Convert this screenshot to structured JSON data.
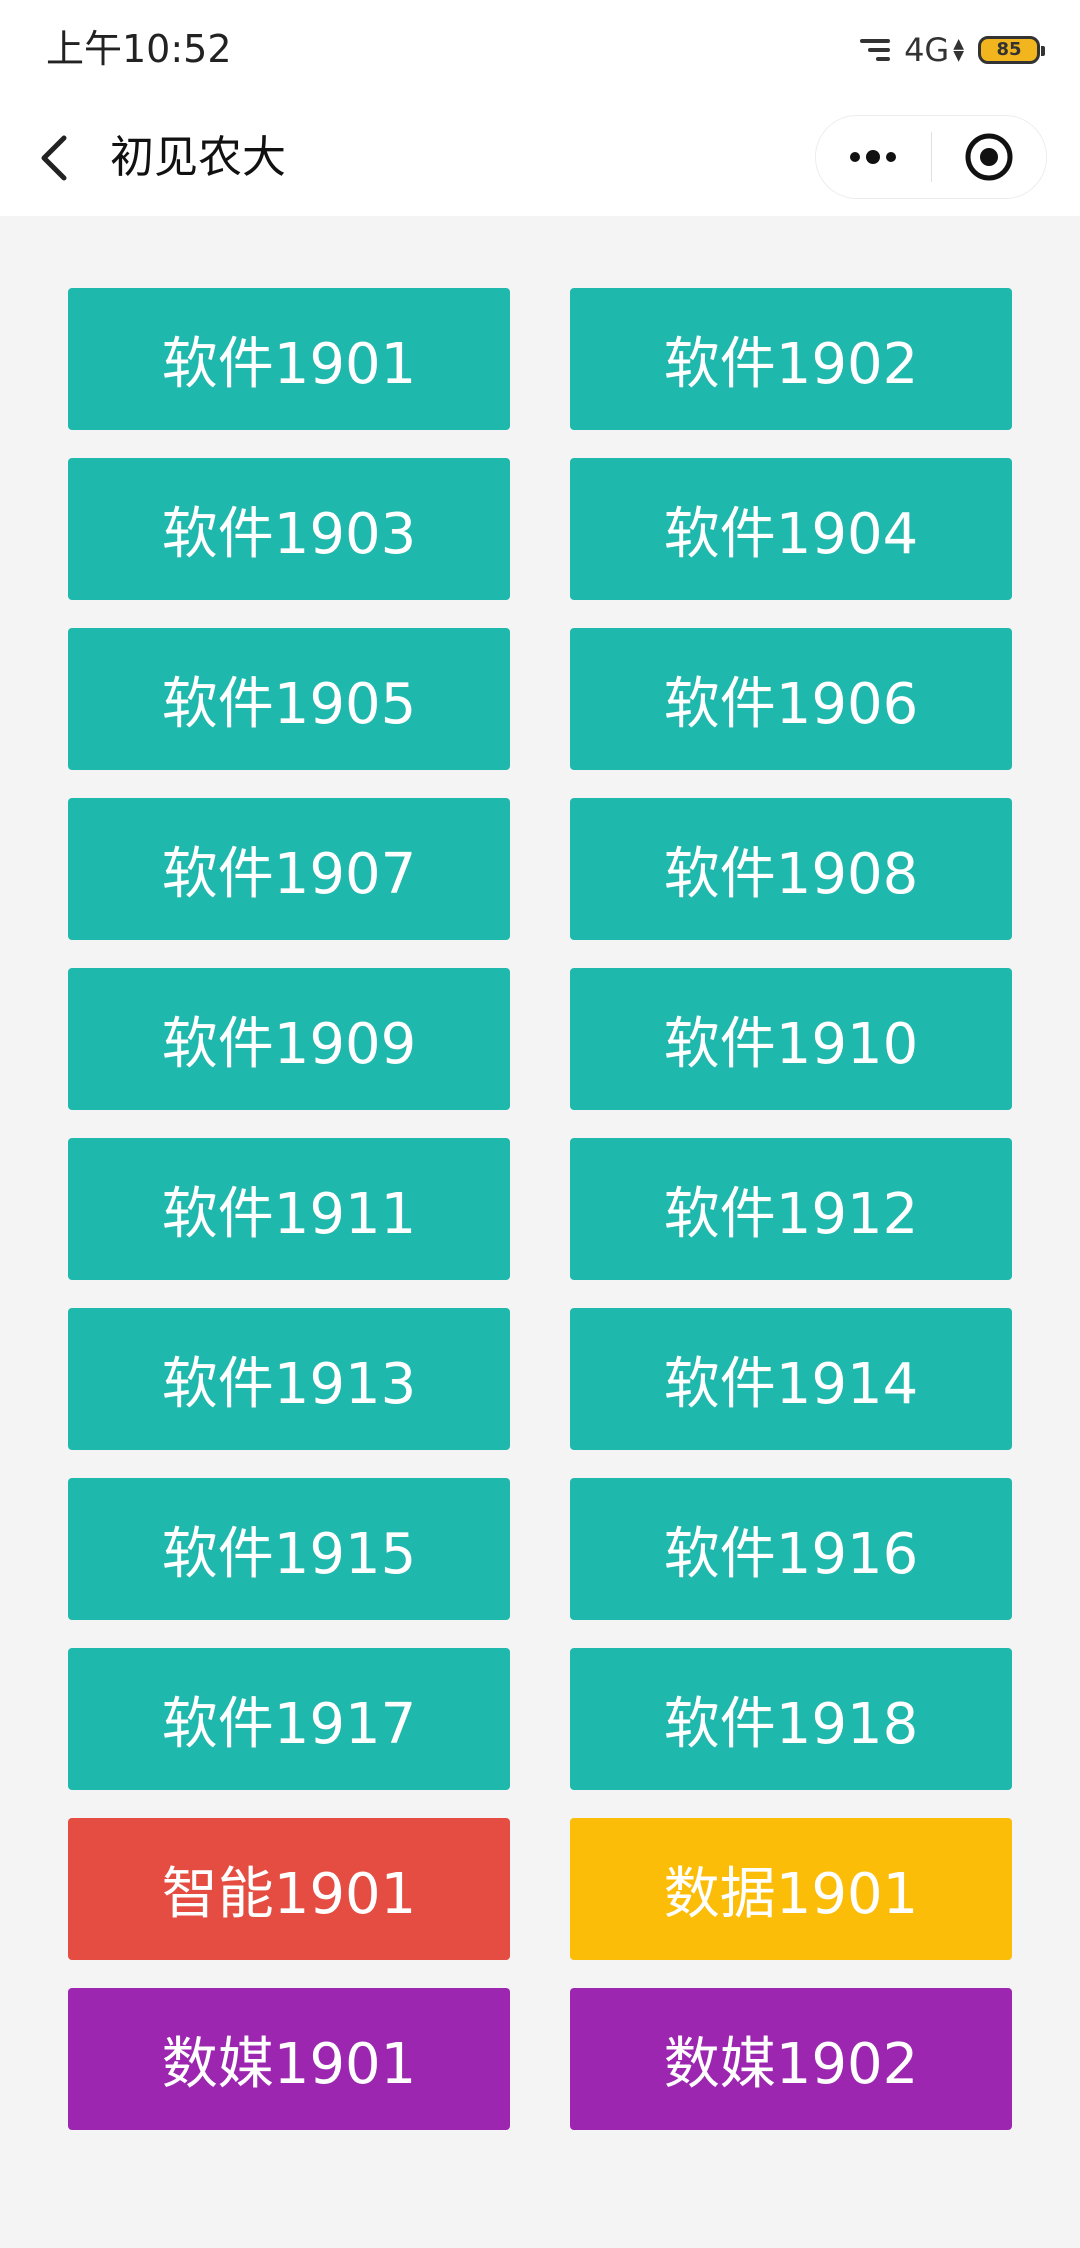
{
  "status_bar": {
    "time": "上午10:52",
    "network": "4G",
    "battery_level": "85",
    "battery_color": "#f2b51e"
  },
  "nav": {
    "title": "初见农大",
    "back_icon": "chevron-left-icon",
    "more_icon": "more-dots-icon",
    "close_icon": "target-circle-icon"
  },
  "colors": {
    "software": "#1fb8ad",
    "intelligence": "#e54d42",
    "data": "#fbbd08",
    "media": "#9c26b0",
    "background": "#f4f4f4"
  },
  "classes": [
    {
      "label": "软件1901",
      "color": "#1fb8ad"
    },
    {
      "label": "软件1902",
      "color": "#1fb8ad"
    },
    {
      "label": "软件1903",
      "color": "#1fb8ad"
    },
    {
      "label": "软件1904",
      "color": "#1fb8ad"
    },
    {
      "label": "软件1905",
      "color": "#1fb8ad"
    },
    {
      "label": "软件1906",
      "color": "#1fb8ad"
    },
    {
      "label": "软件1907",
      "color": "#1fb8ad"
    },
    {
      "label": "软件1908",
      "color": "#1fb8ad"
    },
    {
      "label": "软件1909",
      "color": "#1fb8ad"
    },
    {
      "label": "软件1910",
      "color": "#1fb8ad"
    },
    {
      "label": "软件1911",
      "color": "#1fb8ad"
    },
    {
      "label": "软件1912",
      "color": "#1fb8ad"
    },
    {
      "label": "软件1913",
      "color": "#1fb8ad"
    },
    {
      "label": "软件1914",
      "color": "#1fb8ad"
    },
    {
      "label": "软件1915",
      "color": "#1fb8ad"
    },
    {
      "label": "软件1916",
      "color": "#1fb8ad"
    },
    {
      "label": "软件1917",
      "color": "#1fb8ad"
    },
    {
      "label": "软件1918",
      "color": "#1fb8ad"
    },
    {
      "label": "智能1901",
      "color": "#e54d42"
    },
    {
      "label": "数据1901",
      "color": "#fbbd08"
    },
    {
      "label": "数媒1901",
      "color": "#9c26b0"
    },
    {
      "label": "数媒1902",
      "color": "#9c26b0"
    }
  ]
}
